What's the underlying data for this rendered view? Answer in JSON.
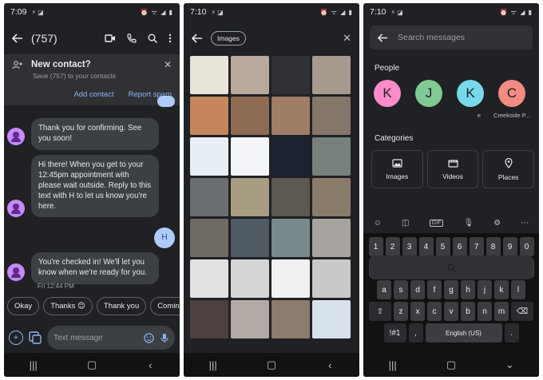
{
  "panel1": {
    "status": {
      "time": "7:09",
      "icons": "⚡ ◪",
      "right": "⏰ ᯤ ◢ ▮"
    },
    "title": "(757)",
    "banner": {
      "title": "New contact?",
      "subtitle": "Save (757) to your contacts",
      "add_label": "Add contact",
      "spam_label": "Report spam"
    },
    "messages": [
      "Thank you for confirming. See you soon!",
      "Hi there! When you get to your 12:45pm appointment with please wait outside. Reply to this text with H to let us know you're here.",
      "You're checked in! We'll let you know when we're ready for you."
    ],
    "outgoing": "H",
    "timestamp": "Fri 12:44 PM",
    "chips": [
      "Okay",
      "Thanks 😊",
      "Thank you",
      "Coming"
    ],
    "compose_placeholder": "Text message"
  },
  "panel2": {
    "status": {
      "time": "7:10",
      "icons": "⚡ ◪",
      "right": "⏰ ᯤ ◢ ▮"
    },
    "filter_label": "Images",
    "tiles": [
      "#e9e4da",
      "#b9a99a",
      "#2f3136",
      "#a69a8f",
      "#c4865a",
      "#8e6b55",
      "#9f7d66",
      "#85766a",
      "#e8eef6",
      "#f3f5f8",
      "#1c2230",
      "#77807a",
      "#6a6e70",
      "#a59c82",
      "#5e5852",
      "#8a7c6a",
      "#6f6a62",
      "#4f5a62",
      "#7a8a8c",
      "#a7a49f",
      "#e2e2e4",
      "#d5d5d8",
      "#f1f1f2",
      "#c9c9cc",
      "#4d4040",
      "#b2aaa4",
      "#8b7c6e",
      "#d7e1ec"
    ]
  },
  "panel3": {
    "status": {
      "time": "7:10",
      "icons": "⚡ ◪",
      "right": "⏰ ᯤ ◢ ▮"
    },
    "search_placeholder": "Search messages",
    "people_heading": "People",
    "people": [
      {
        "initial": "K",
        "name": "",
        "color": "#ff8bcb"
      },
      {
        "initial": "J",
        "name": "",
        "color": "#81c995"
      },
      {
        "initial": "K",
        "name": "e",
        "color": "#78d9ec"
      },
      {
        "initial": "C",
        "name": "Creekside P...",
        "color": "#f28b82"
      }
    ],
    "categories_heading": "Categories",
    "categories": [
      {
        "label": "Images",
        "icon": "image-icon"
      },
      {
        "label": "Videos",
        "icon": "video-icon"
      },
      {
        "label": "Places",
        "icon": "place-icon"
      }
    ],
    "keyboard": {
      "row1": [
        "1",
        "2",
        "3",
        "4",
        "5",
        "6",
        "7",
        "8",
        "9",
        "0"
      ],
      "row2": [
        "q",
        "w",
        "e",
        "r",
        "t",
        "y",
        "u",
        "i",
        "o",
        "p"
      ],
      "row3": [
        "a",
        "s",
        "d",
        "f",
        "g",
        "h",
        "j",
        "k",
        "l"
      ],
      "row4": [
        "z",
        "x",
        "c",
        "v",
        "b",
        "n",
        "m"
      ],
      "symbols": "!#1",
      "comma": ",",
      "space": "English (US)",
      "period": "."
    }
  }
}
